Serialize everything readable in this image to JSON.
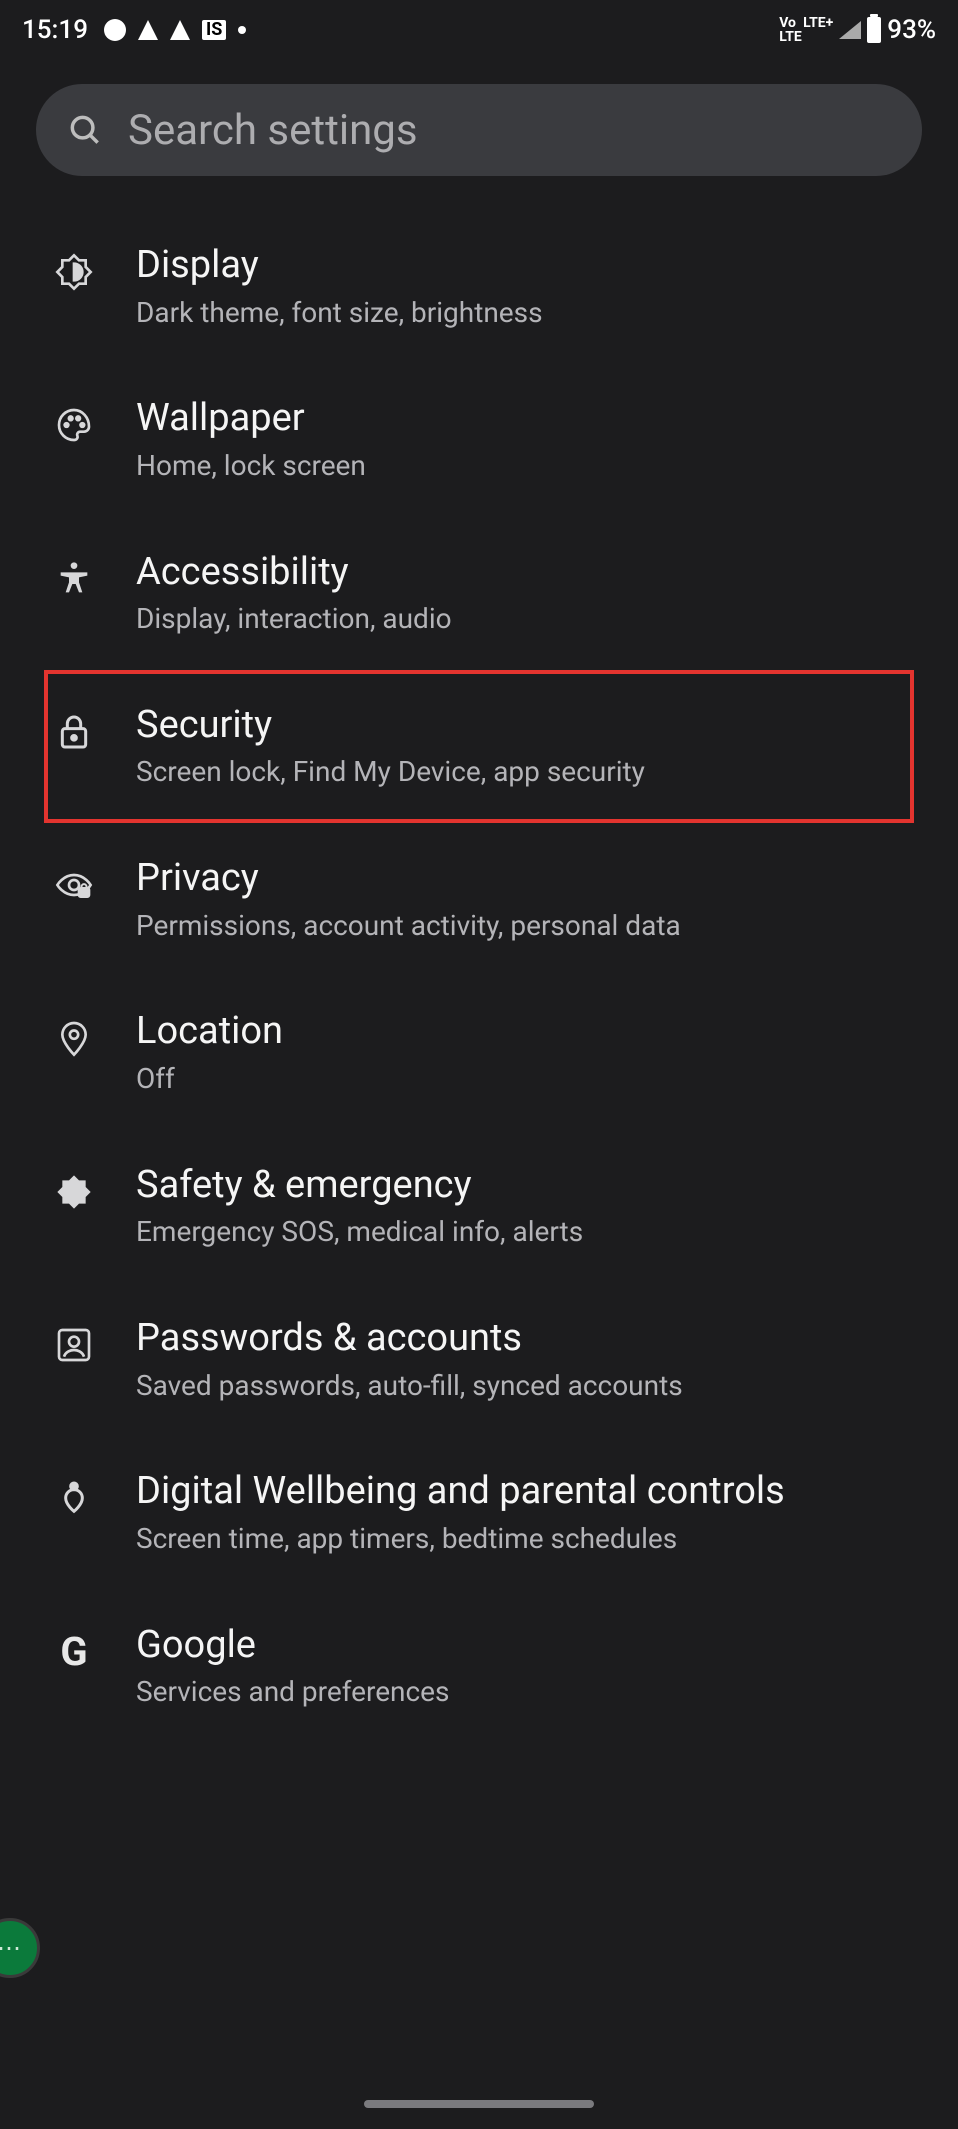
{
  "status": {
    "time": "15:19",
    "is_label": "IS",
    "lte_top": "Vo LTE+",
    "lte_bot": "LTE",
    "battery": "93%"
  },
  "search": {
    "placeholder": "Search settings"
  },
  "items": [
    {
      "key": "display",
      "title": "Display",
      "sub": "Dark theme, font size, brightness",
      "icon": "brightness-icon"
    },
    {
      "key": "wallpaper",
      "title": "Wallpaper",
      "sub": "Home, lock screen",
      "icon": "palette-icon"
    },
    {
      "key": "accessibility",
      "title": "Accessibility",
      "sub": "Display, interaction, audio",
      "icon": "accessibility-icon"
    },
    {
      "key": "security",
      "title": "Security",
      "sub": "Screen lock, Find My Device, app security",
      "icon": "lock-icon",
      "highlighted": true
    },
    {
      "key": "privacy",
      "title": "Privacy",
      "sub": "Permissions, account activity, personal data",
      "icon": "privacy-icon"
    },
    {
      "key": "location",
      "title": "Location",
      "sub": "Off",
      "icon": "location-icon"
    },
    {
      "key": "safety",
      "title": "Safety & emergency",
      "sub": "Emergency SOS, medical info, alerts",
      "icon": "medical-icon"
    },
    {
      "key": "passwords",
      "title": "Passwords & accounts",
      "sub": "Saved passwords, auto-fill, synced accounts",
      "icon": "account-icon"
    },
    {
      "key": "wellbeing",
      "title": "Digital Wellbeing and parental controls",
      "sub": "Screen time, app timers, bedtime schedules",
      "icon": "wellbeing-icon"
    },
    {
      "key": "google",
      "title": "Google",
      "sub": "Services and preferences",
      "icon": "google-icon"
    }
  ]
}
